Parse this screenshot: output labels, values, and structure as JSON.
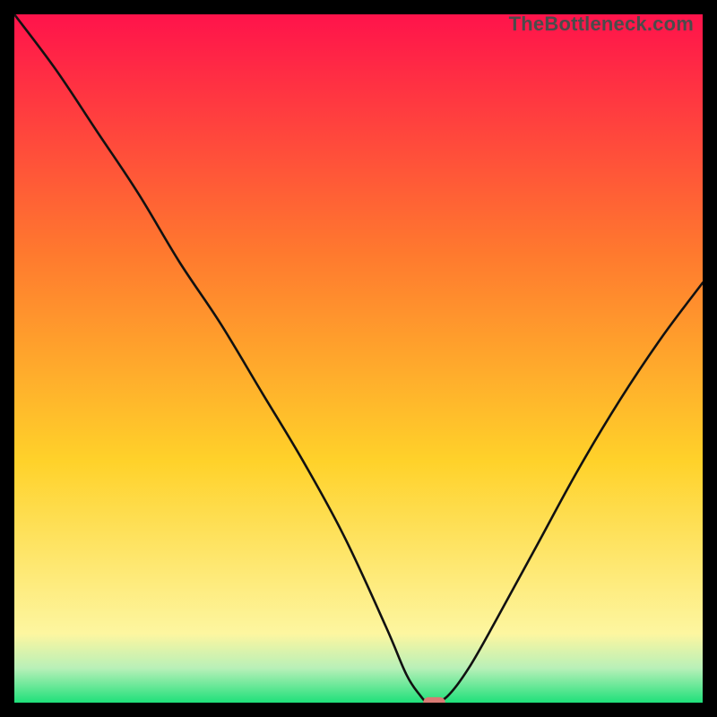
{
  "watermark": "TheBottleneck.com",
  "colors": {
    "bg": "#000000",
    "text_muted": "#4b4b4b",
    "marker": "#d97a74",
    "curve": "#111111",
    "gradient_top": "#ff134b",
    "gradient_mid1": "#ff7a2e",
    "gradient_mid2": "#ffd22a",
    "gradient_paleyellow": "#fdf6a0",
    "gradient_palegreen": "#b8f0b8",
    "gradient_green": "#1fe07a"
  },
  "chart_data": {
    "type": "line",
    "title": "",
    "xlabel": "",
    "ylabel": "",
    "xlim": [
      0,
      100
    ],
    "ylim": [
      0,
      100
    ],
    "notes": "V-shaped bottleneck curve on a vertical rainbow (red→green) gradient background. Y is percentage mismatch; X is relative hardware position. Curve minimum sits near x≈61 at y≈0. A small rounded marker highlights the minimum.",
    "series": [
      {
        "name": "bottleneck-curve",
        "x": [
          0,
          6,
          12,
          18,
          24,
          30,
          36,
          42,
          48,
          54,
          57,
          59,
          60,
          61,
          63,
          66,
          70,
          76,
          82,
          88,
          94,
          100
        ],
        "y": [
          100,
          92,
          83,
          74,
          64,
          55,
          45,
          35,
          24,
          11,
          4,
          1,
          0,
          0,
          1,
          5,
          12,
          23,
          34,
          44,
          53,
          61
        ]
      }
    ],
    "marker": {
      "x": 61,
      "y": 0,
      "w_pct": 3.2,
      "h_pct": 1.6
    },
    "gradient_stops_pct": [
      0,
      35,
      65,
      90,
      95,
      100
    ]
  }
}
